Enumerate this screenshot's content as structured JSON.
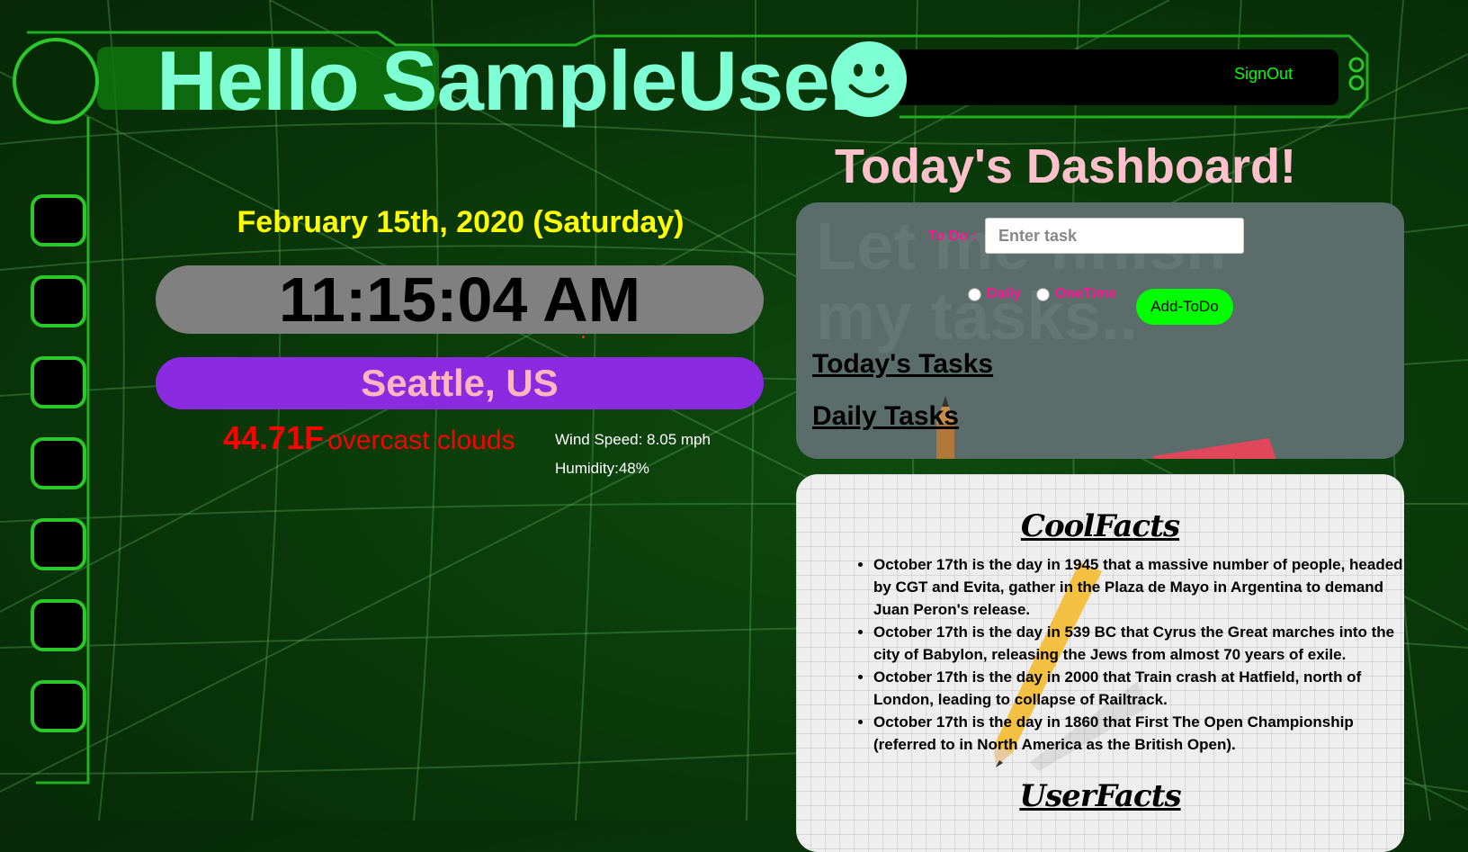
{
  "header": {
    "greeting": "Hello SampleUser",
    "signout_label": "SignOut"
  },
  "weather": {
    "date": "February 15th, 2020 (Saturday)",
    "time": "11:15:04 AM",
    "city": "Seattle, US",
    "temperature": "44.71F",
    "description": "overcast clouds",
    "wind": "Wind Speed: 8.05 mph",
    "humidity": "Humidity:48%"
  },
  "dashboard": {
    "title": "Today's Dashboard!",
    "watermark": "Let me finish my tasks..",
    "todo_label": "To Do :",
    "todo_placeholder": "Enter task",
    "radio_daily": "Daily",
    "radio_onetime": "OneTime",
    "add_button": "Add-ToDo",
    "todays_tasks": "Today's Tasks",
    "daily_tasks": "Daily Tasks"
  },
  "facts": {
    "cool_title": "CoolFacts",
    "items": [
      "October 17th is the day in 1945 that a massive number of people, headed by CGT and Evita, gather in the Plaza de Mayo in Argentina to demand Juan Peron's release.",
      "October 17th is the day in 539 BC that Cyrus the Great marches into the city of Babylon, releasing the Jews from almost 70 years of exile.",
      "October 17th is the day in 2000 that Train crash at Hatfield, north of London, leading to collapse of Railtrack.",
      "October 17th is the day in 1860 that First The Open Championship (referred to in North America as the British Open)."
    ],
    "user_title": "UserFacts"
  },
  "colors": {
    "greeting": "#7fffd4",
    "date": "#ffff00",
    "clock_bg": "#808080",
    "city_bg": "#8a2be2",
    "city_text": "#ffb6c1",
    "temperature": "#ff0000",
    "dashboard_title": "#ffc0cb",
    "todo_panel": "#5a6d6b",
    "add_button": "#00ff00",
    "signout": "#00ff00"
  }
}
